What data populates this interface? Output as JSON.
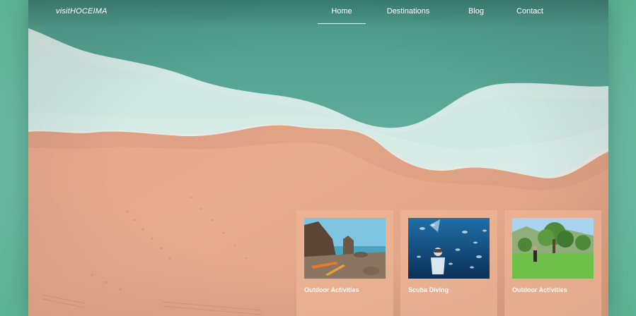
{
  "site": {
    "logo": "visitHOCEIMA"
  },
  "nav": {
    "items": [
      {
        "label": "Home",
        "active": true
      },
      {
        "label": "Destinations",
        "active": false
      },
      {
        "label": "Blog",
        "active": false
      },
      {
        "label": "Contact",
        "active": false
      }
    ]
  },
  "cards": [
    {
      "title": "Outdoor Activities",
      "image": "rocky-coast-kayaks"
    },
    {
      "title": "Scuba Diving",
      "image": "diver-with-fish"
    },
    {
      "title": "Outdoor Activities",
      "image": "hiker-in-green-meadow"
    }
  ],
  "colors": {
    "outer_background": "#6dbba3",
    "sand": "#e6a98a",
    "sea": "#4f9a8a",
    "card_overlay": "#ecb696",
    "text": "#ffffff"
  }
}
